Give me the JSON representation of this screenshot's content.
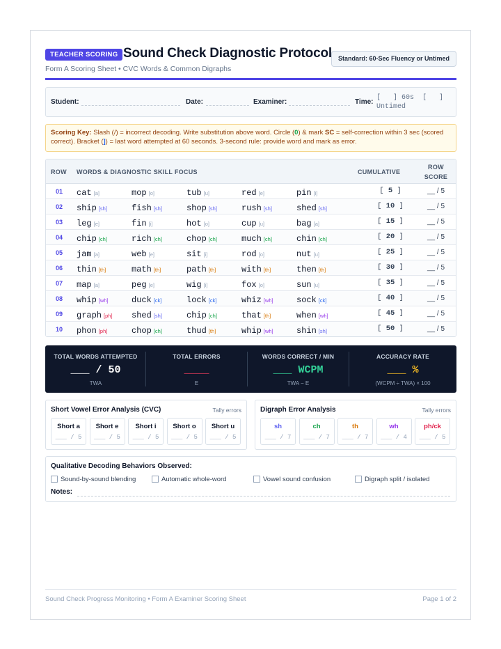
{
  "header": {
    "badge": "TEACHER SCORING",
    "title": "Sound Check Diagnostic Protocol",
    "subtitle": "Form A Scoring Sheet • CVC Words & Common Digraphs",
    "standard": "Standard: 60-Sec Fluency or Untimed"
  },
  "info": {
    "student_label": "Student:",
    "date_label": "Date:",
    "examiner_label": "Examiner:",
    "time_label": "Time:",
    "time_option_1": "[   ] 60s  [   ]",
    "time_option_2": "Untimed"
  },
  "key": {
    "label": "Scoring Key:",
    "text_1": "Slash (/) = incorrect decoding. Write substitution above word. Circle (",
    "circle_symbol": "0",
    "text_2": ") & mark",
    "sc": "SC",
    "text_3": "= self-correction within 3 sec (scored correct). Bracket (",
    "bracket_symbol": "]",
    "text_4": ") = last word attempted at 60 seconds. 3-second rule: provide word and mark as error."
  },
  "table": {
    "headers": {
      "row": "ROW",
      "words": "WORDS & DIAGNOSTIC SKILL FOCUS",
      "cumulative": "CUMULATIVE",
      "row_score_1": "ROW",
      "row_score_2": "SCORE"
    },
    "row_score_text": "__ / 5",
    "rows": [
      {
        "num": "01",
        "cum": "5",
        "words": [
          {
            "w": "cat",
            "s": "[a]"
          },
          {
            "w": "mop",
            "s": "[o]"
          },
          {
            "w": "tub",
            "s": "[u]"
          },
          {
            "w": "red",
            "s": "[e]"
          },
          {
            "w": "pin",
            "s": "[i]"
          }
        ]
      },
      {
        "num": "02",
        "cum": "10",
        "words": [
          {
            "w": "ship",
            "s": "[sh]"
          },
          {
            "w": "fish",
            "s": "[sh]"
          },
          {
            "w": "shop",
            "s": "[sh]"
          },
          {
            "w": "rush",
            "s": "[sh]"
          },
          {
            "w": "shed",
            "s": "[sh]"
          }
        ]
      },
      {
        "num": "03",
        "cum": "15",
        "words": [
          {
            "w": "leg",
            "s": "[e]"
          },
          {
            "w": "fin",
            "s": "[i]"
          },
          {
            "w": "hot",
            "s": "[o]"
          },
          {
            "w": "cup",
            "s": "[u]"
          },
          {
            "w": "bag",
            "s": "[a]"
          }
        ]
      },
      {
        "num": "04",
        "cum": "20",
        "words": [
          {
            "w": "chip",
            "s": "[ch]"
          },
          {
            "w": "rich",
            "s": "[ch]"
          },
          {
            "w": "chop",
            "s": "[ch]"
          },
          {
            "w": "much",
            "s": "[ch]"
          },
          {
            "w": "chin",
            "s": "[ch]"
          }
        ]
      },
      {
        "num": "05",
        "cum": "25",
        "words": [
          {
            "w": "jam",
            "s": "[a]"
          },
          {
            "w": "web",
            "s": "[e]"
          },
          {
            "w": "sit",
            "s": "[i]"
          },
          {
            "w": "rod",
            "s": "[o]"
          },
          {
            "w": "nut",
            "s": "[u]"
          }
        ]
      },
      {
        "num": "06",
        "cum": "30",
        "words": [
          {
            "w": "thin",
            "s": "[th]"
          },
          {
            "w": "math",
            "s": "[th]"
          },
          {
            "w": "path",
            "s": "[th]"
          },
          {
            "w": "with",
            "s": "[th]"
          },
          {
            "w": "then",
            "s": "[th]"
          }
        ]
      },
      {
        "num": "07",
        "cum": "35",
        "words": [
          {
            "w": "map",
            "s": "[a]"
          },
          {
            "w": "peg",
            "s": "[e]"
          },
          {
            "w": "wig",
            "s": "[i]"
          },
          {
            "w": "fox",
            "s": "[o]"
          },
          {
            "w": "sun",
            "s": "[u]"
          }
        ]
      },
      {
        "num": "08",
        "cum": "40",
        "words": [
          {
            "w": "whip",
            "s": "[wh]"
          },
          {
            "w": "duck",
            "s": "[ck]"
          },
          {
            "w": "lock",
            "s": "[ck]"
          },
          {
            "w": "whiz",
            "s": "[wh]"
          },
          {
            "w": "sock",
            "s": "[ck]"
          }
        ]
      },
      {
        "num": "09",
        "cum": "45",
        "words": [
          {
            "w": "graph",
            "s": "[ph]"
          },
          {
            "w": "shed",
            "s": "[sh]"
          },
          {
            "w": "chip",
            "s": "[ch]"
          },
          {
            "w": "that",
            "s": "[th]"
          },
          {
            "w": "when",
            "s": "[wh]"
          }
        ]
      },
      {
        "num": "10",
        "cum": "50",
        "words": [
          {
            "w": "phon",
            "s": "[ph]"
          },
          {
            "w": "chop",
            "s": "[ch]"
          },
          {
            "w": "thud",
            "s": "[th]"
          },
          {
            "w": "whip",
            "s": "[wh]"
          },
          {
            "w": "shin",
            "s": "[sh]"
          }
        ]
      }
    ]
  },
  "skill_colors": {
    "vowel": "#94a3b8",
    "sh": "#6366f1",
    "ch": "#16a34a",
    "th": "#d97706",
    "wh": "#9333ea",
    "ck": "#2563eb",
    "ph": "#e11d48"
  },
  "totals": {
    "twa": {
      "heading": "TOTAL WORDS ATTEMPTED",
      "value": "___ / 50",
      "sub": "TWA"
    },
    "errors": {
      "heading": "TOTAL ERRORS",
      "value": "____",
      "sub": "E"
    },
    "wcpm": {
      "heading": "WORDS CORRECT / MIN",
      "value": "___ WCPM",
      "sub": "TWA − E"
    },
    "accuracy": {
      "heading": "ACCURACY RATE",
      "value": "___ %",
      "sub": "(WCPM ÷ TWA) × 100"
    }
  },
  "vowel_analysis": {
    "heading": "Short Vowel Error Analysis (CVC)",
    "tally": "Tally errors",
    "cells": [
      {
        "label": "Short a",
        "value": "___ / 5"
      },
      {
        "label": "Short e",
        "value": "___ / 5"
      },
      {
        "label": "Short i",
        "value": "___ / 5"
      },
      {
        "label": "Short o",
        "value": "___ / 5"
      },
      {
        "label": "Short u",
        "value": "___ / 5"
      }
    ]
  },
  "digraph_analysis": {
    "heading": "Digraph Error Analysis",
    "tally": "Tally errors",
    "cells": [
      {
        "label": "sh",
        "value": "___ / 7",
        "color": "#6366f1"
      },
      {
        "label": "ch",
        "value": "___ / 7",
        "color": "#16a34a"
      },
      {
        "label": "th",
        "value": "___ / 7",
        "color": "#d97706"
      },
      {
        "label": "wh",
        "value": "___ / 4",
        "color": "#9333ea"
      },
      {
        "label": "ph/ck",
        "value": "___ / 5",
        "color": "#e11d48"
      }
    ]
  },
  "qualitative": {
    "heading": "Qualitative Decoding Behaviors Observed:",
    "options": [
      "Sound-by-sound blending",
      "Automatic whole-word",
      "Vowel sound confusion",
      "Digraph split / isolated"
    ],
    "notes_label": "Notes:"
  },
  "footer": {
    "left": "Sound Check Progress Monitoring • Form A Examiner Scoring Sheet",
    "right": "Page 1 of 2"
  }
}
